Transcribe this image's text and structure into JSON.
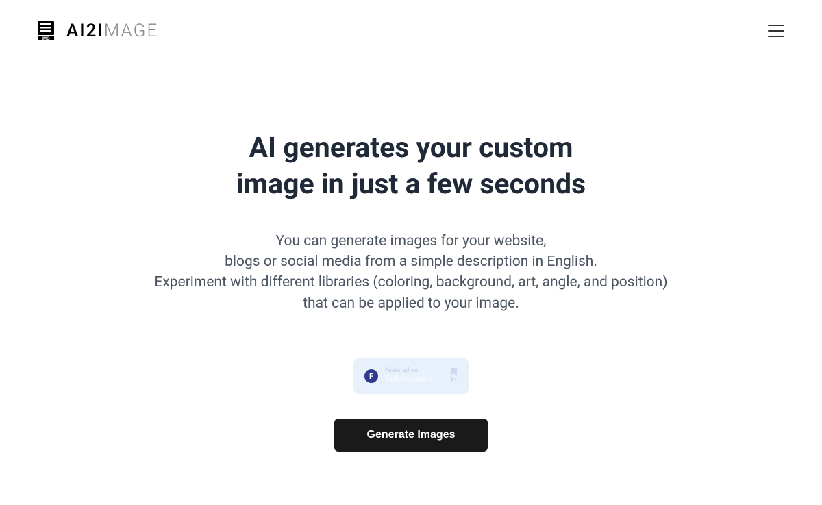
{
  "header": {
    "logo_text_bold": "AI2I",
    "logo_text_light": "MAGE",
    "logo_img_label": "IMG"
  },
  "hero": {
    "title_line1": "AI generates your custom",
    "title_line2": "image in just a few seconds",
    "subtitle_line1": "You can generate images for your website,",
    "subtitle_line2": "blogs or social media from a simple description in English.",
    "subtitle_line3": "Experiment with different libraries (coloring, background, art, angle, and position)",
    "subtitle_line4": "that can be applied to your image."
  },
  "badge": {
    "letter": "F",
    "top_text": "Featured on",
    "brand": "Futurepedia",
    "count": "71"
  },
  "cta": {
    "label": "Generate Images"
  }
}
